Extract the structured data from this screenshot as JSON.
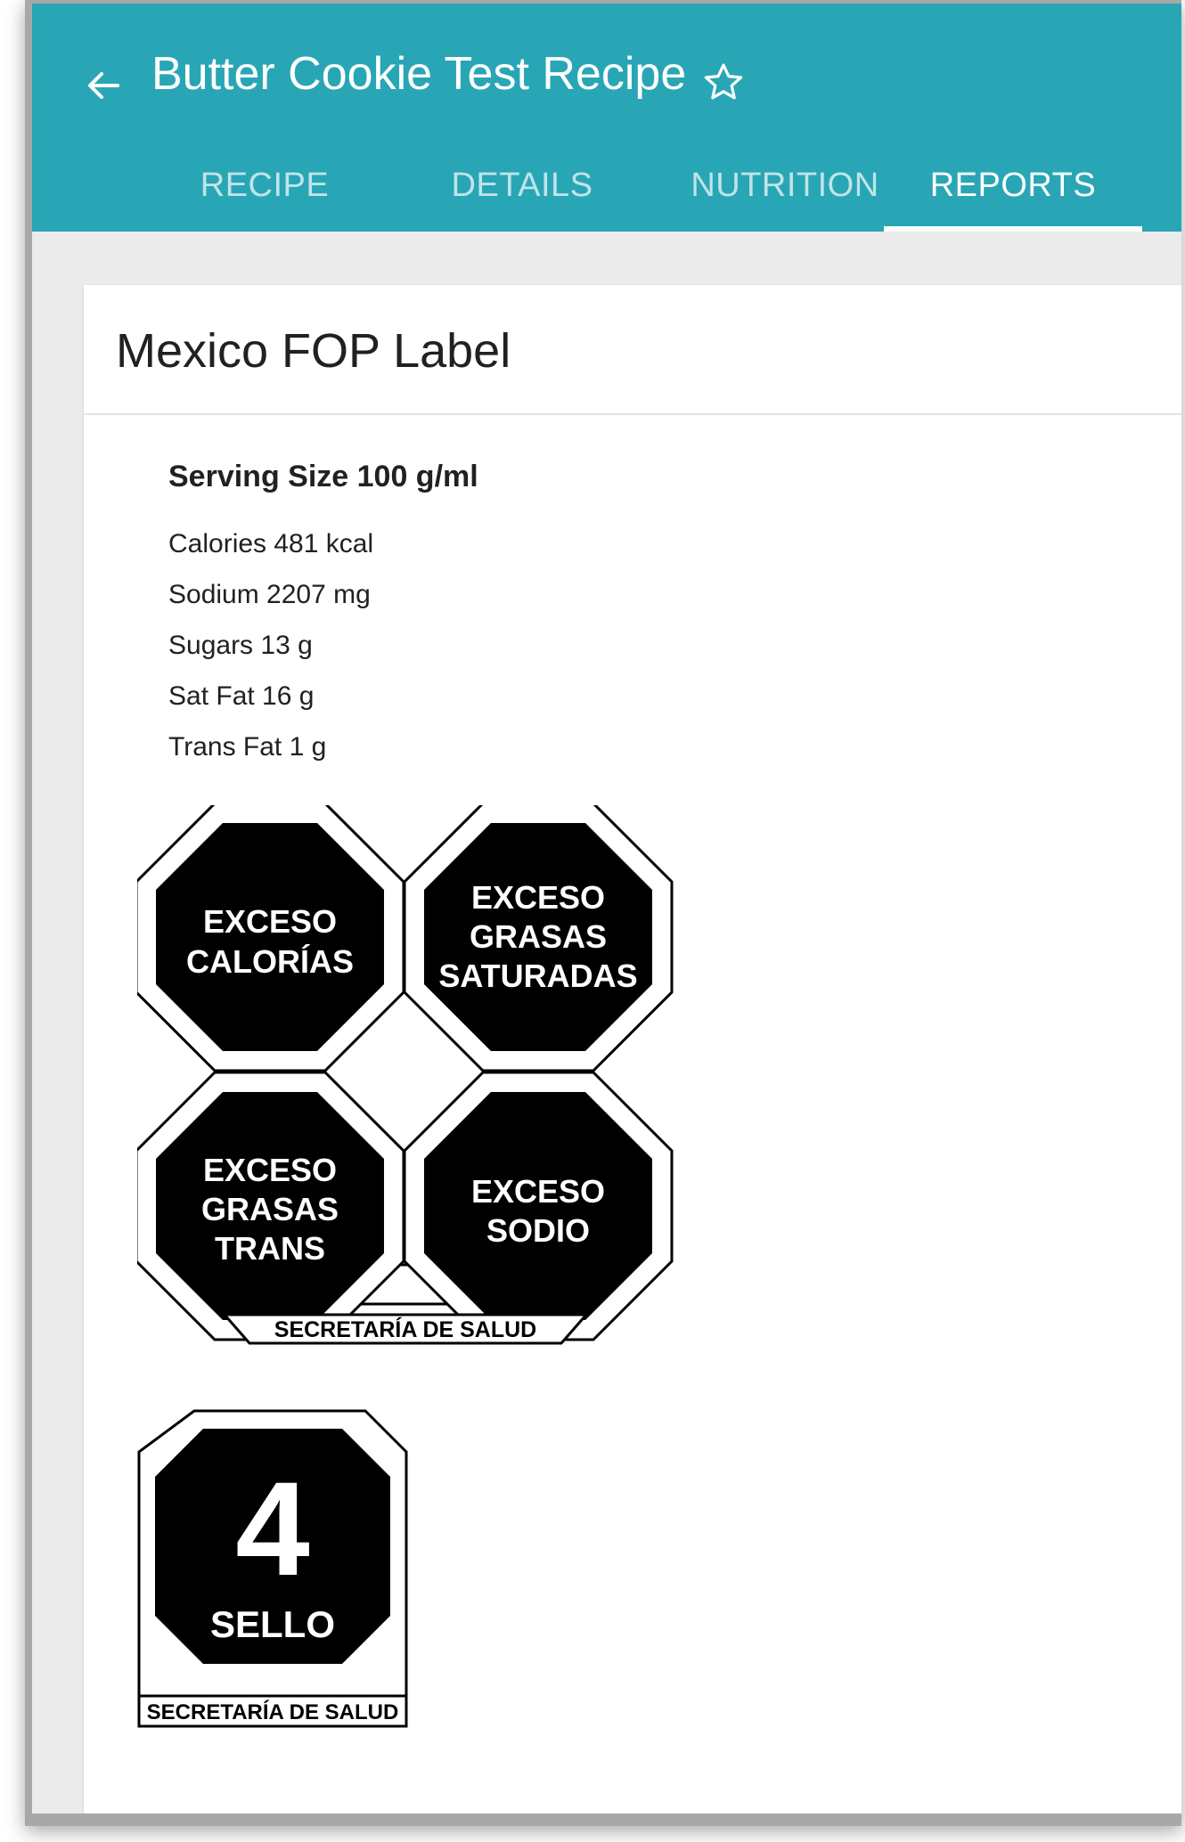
{
  "appbar": {
    "title": "Butter Cookie Test Recipe",
    "back_icon": "arrow-left-icon",
    "favorite_icon": "star-outline-icon",
    "color": "#29a6b5"
  },
  "tabs": [
    {
      "label": "RECIPE",
      "active": false
    },
    {
      "label": "DETAILS",
      "active": false
    },
    {
      "label": "NUTRITION",
      "active": false
    },
    {
      "label": "REPORTS",
      "active": true
    }
  ],
  "report": {
    "title": "Mexico FOP Label",
    "serving_size": "Serving Size 100 g/ml",
    "nutrients": [
      "Calories 481 kcal",
      "Sodium 2207 mg",
      "Sugars 13 g",
      "Sat Fat 16 g",
      "Trans Fat 1 g"
    ]
  },
  "seals": {
    "calorias": [
      "EXCESO",
      "CALORÍAS"
    ],
    "grasas_saturadas": [
      "EXCESO",
      "GRASAS",
      "SATURADAS"
    ],
    "grasas_trans": [
      "EXCESO",
      "GRASAS",
      "TRANS"
    ],
    "sodio": [
      "EXCESO",
      "SODIO"
    ],
    "footer": "SECRETARÍA DE SALUD"
  },
  "sello": {
    "count": "4",
    "label": "SELLO",
    "footer": "SECRETARÍA DE SALUD"
  }
}
